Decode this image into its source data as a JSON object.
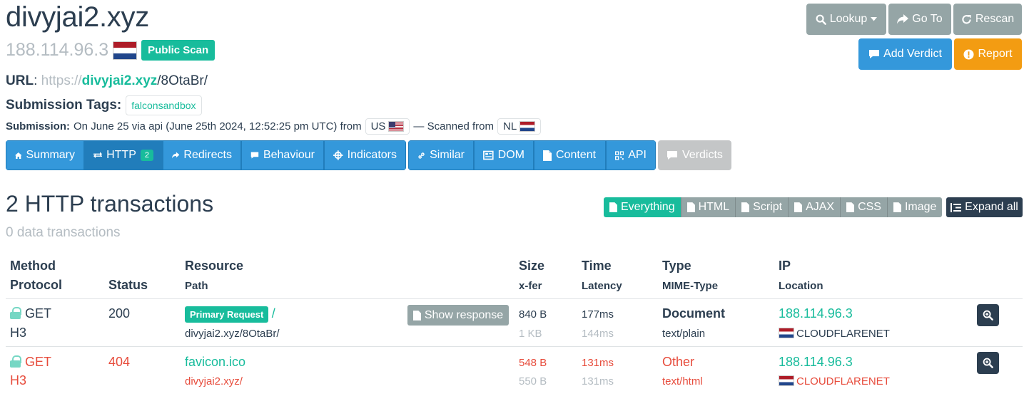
{
  "header": {
    "domain": "divyjai2.xyz",
    "ip": "188.114.96.3",
    "scan_badge": "Public Scan",
    "url_label": "URL",
    "url_scheme": "https://",
    "url_host": "divyjai2.xyz",
    "url_path": "/8OtaBr/",
    "tags_label": "Submission Tags:",
    "tag": "falconsandbox",
    "submission_label": "Submission:",
    "submission_text": "On June 25 via api (June 25th 2024, 12:52:25 pm UTC) from",
    "from_country": "US",
    "scanned_from_text": "— Scanned from",
    "scan_country": "NL"
  },
  "actions": {
    "lookup": "Lookup",
    "goto": "Go To",
    "rescan": "Rescan",
    "add_verdict": "Add Verdict",
    "report": "Report"
  },
  "nav": {
    "summary": "Summary",
    "http": "HTTP",
    "http_count": "2",
    "redirects": "Redirects",
    "behaviour": "Behaviour",
    "indicators": "Indicators",
    "similar": "Similar",
    "dom": "DOM",
    "content": "Content",
    "api": "API",
    "verdicts": "Verdicts"
  },
  "section": {
    "title": "2 HTTP transactions",
    "subtitle": "0 data transactions",
    "filters": [
      "Everything",
      "HTML",
      "Script",
      "AJAX",
      "CSS",
      "Image"
    ],
    "expand_all": "Expand all"
  },
  "table": {
    "headers": {
      "method": "Method",
      "protocol": "Protocol",
      "status": "Status",
      "resource": "Resource",
      "path": "Path",
      "size": "Size",
      "xfer": "x-fer",
      "time": "Time",
      "latency": "Latency",
      "type": "Type",
      "mime": "MIME-Type",
      "ip": "IP",
      "location": "Location"
    },
    "rows": [
      {
        "method": "GET",
        "protocol": "H3",
        "status": "200",
        "badge": "Primary Request",
        "resource": "/",
        "path": "divyjai2.xyz/8OtaBr/",
        "show_response": "Show response",
        "size": "840 B",
        "xfer": "1 KB",
        "time": "177ms",
        "latency": "144ms",
        "type": "Document",
        "mime": "text/plain",
        "ip": "188.114.96.3",
        "location": "CLOUDFLARENET"
      },
      {
        "method": "GET",
        "protocol": "H3",
        "status": "404",
        "resource": "favicon.ico",
        "path": "divyjai2.xyz/",
        "size": "548 B",
        "xfer": "550 B",
        "time": "131ms",
        "latency": "131ms",
        "type": "Other",
        "mime": "text/html",
        "ip": "188.114.96.3",
        "location": "CLOUDFLARENET"
      }
    ]
  }
}
